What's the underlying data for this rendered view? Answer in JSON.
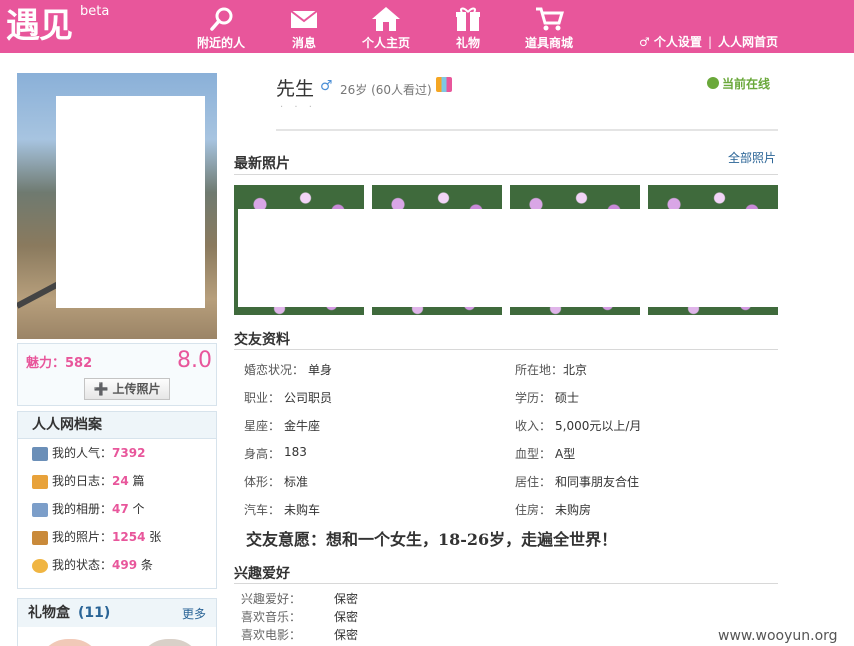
{
  "brand": {
    "logo": "遇见",
    "beta": "beta"
  },
  "nav": [
    {
      "label": "附近的人",
      "icon": "search-icon"
    },
    {
      "label": "消息",
      "icon": "mail-icon"
    },
    {
      "label": "个人主页",
      "icon": "home-icon"
    },
    {
      "label": "礼物",
      "icon": "gift-icon"
    },
    {
      "label": "道具商城",
      "icon": "cart-icon"
    }
  ],
  "top_right": {
    "settings": "♂ 个人设置",
    "separator": "|",
    "renren_home": "人人网首页"
  },
  "profile": {
    "name": "先生",
    "gender_symbol": "♂",
    "age_text": "26岁 (60人看过)",
    "dots": "· · ·",
    "online_status": "当前在线"
  },
  "charm": {
    "label": "魅力：582",
    "score": "8.0",
    "upload_button": "➕ 上传照片"
  },
  "archive": {
    "title": "人人网档案",
    "rows": [
      {
        "prefix": "我的人气：",
        "num": "7392",
        "unit": ""
      },
      {
        "prefix": "我的日志：",
        "num": "24",
        "unit": " 篇"
      },
      {
        "prefix": "我的相册：",
        "num": "47",
        "unit": " 个"
      },
      {
        "prefix": "我的照片：",
        "num": "1254",
        "unit": " 张"
      },
      {
        "prefix": "我的状态：",
        "num": "499",
        "unit": " 条"
      }
    ]
  },
  "giftbox": {
    "title": "礼物盒",
    "count": "(11)",
    "more": "更多"
  },
  "photos": {
    "title": "最新照片",
    "all_link": "全部照片"
  },
  "dating_info": {
    "title": "交友资料",
    "fields": [
      {
        "label": "婚恋状况：",
        "value": "单身"
      },
      {
        "label": "所在地：",
        "value": "北京"
      },
      {
        "label": "职业：",
        "value": "公司职员"
      },
      {
        "label": "学历：",
        "value": "硕士"
      },
      {
        "label": "星座：",
        "value": "金牛座"
      },
      {
        "label": "收入：",
        "value": "5,000元以上/月"
      },
      {
        "label": "身高：",
        "value": "183"
      },
      {
        "label": "血型：",
        "value": "A型"
      },
      {
        "label": "体形：",
        "value": "标准"
      },
      {
        "label": "居住：",
        "value": "和同事朋友合住"
      },
      {
        "label": "汽车：",
        "value": "未购车"
      },
      {
        "label": "住房：",
        "value": "未购房"
      }
    ],
    "wish": "交友意愿：想和一个女生，18-26岁，走遍全世界！"
  },
  "hobbies": {
    "title": "兴趣爱好",
    "rows": [
      {
        "label": "兴趣爱好：",
        "value": "保密"
      },
      {
        "label": "喜欢音乐：",
        "value": "保密"
      },
      {
        "label": "喜欢电影：",
        "value": "保密"
      }
    ]
  },
  "watermark": "www.wooyun.org",
  "colors": {
    "brand_pink": "#e8569b",
    "link_blue": "#2a6496",
    "online_green": "#6aa83a"
  }
}
